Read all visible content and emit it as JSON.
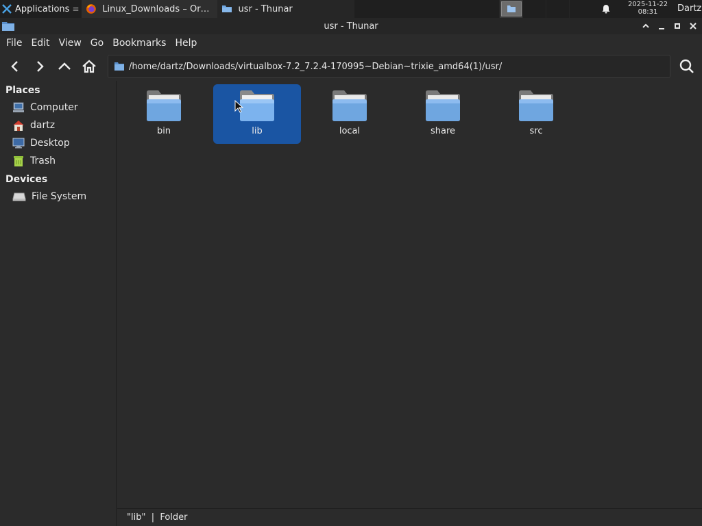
{
  "panel": {
    "apps_label": "Applications",
    "apps_separator": "≡",
    "tasks": [
      {
        "label": "Linux_Downloads – Ora…",
        "icon": "firefox-icon"
      },
      {
        "label": "usr - Thunar",
        "icon": "folder-icon"
      }
    ],
    "clock_date": "2025-11-22",
    "clock_time": "08:31",
    "user": "Dartz"
  },
  "window": {
    "title": "usr - Thunar"
  },
  "menubar": {
    "items": [
      "File",
      "Edit",
      "View",
      "Go",
      "Bookmarks",
      "Help"
    ]
  },
  "toolbar": {
    "path": "/home/dartz/Downloads/virtualbox-7.2_7.2.4-170995~Debian~trixie_amd64(1)/usr/"
  },
  "sidebar": {
    "places_title": "Places",
    "places": [
      {
        "label": "Computer",
        "icon": "computer-icon"
      },
      {
        "label": "dartz",
        "icon": "home-icon"
      },
      {
        "label": "Desktop",
        "icon": "desktop-icon"
      },
      {
        "label": "Trash",
        "icon": "trash-icon"
      }
    ],
    "devices_title": "Devices",
    "devices": [
      {
        "label": "File System",
        "icon": "drive-icon"
      }
    ]
  },
  "files": [
    {
      "name": "bin",
      "selected": false
    },
    {
      "name": "lib",
      "selected": true
    },
    {
      "name": "local",
      "selected": false
    },
    {
      "name": "share",
      "selected": false
    },
    {
      "name": "src",
      "selected": false
    }
  ],
  "statusbar": {
    "text": "\"lib\"  |  Folder"
  },
  "colors": {
    "selection": "#1a55a3",
    "folder": "#6fa6e0",
    "background": "#2b2b2b"
  }
}
